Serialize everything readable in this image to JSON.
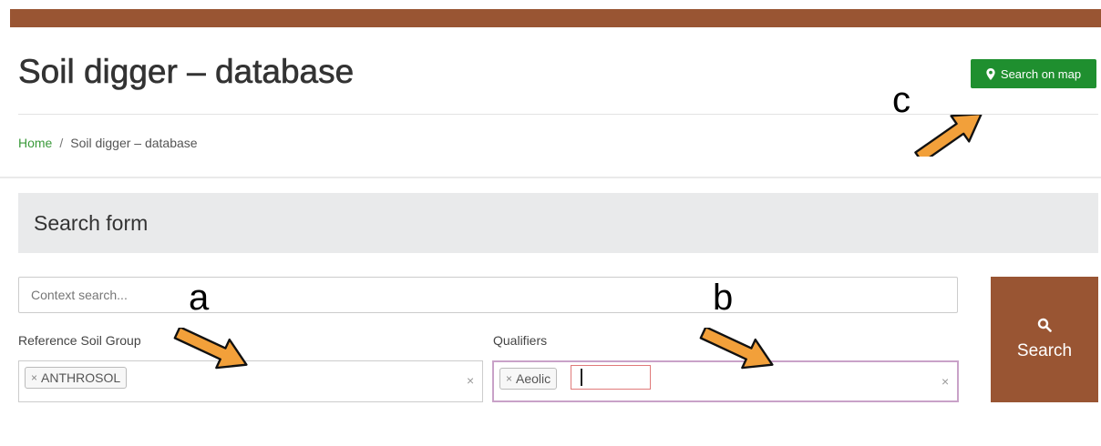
{
  "header": {
    "title": "Soil digger – database",
    "map_button_label": "Search on map"
  },
  "breadcrumb": {
    "home": "Home",
    "separator": "/",
    "current": "Soil digger – database"
  },
  "search_form": {
    "title": "Search form",
    "context_placeholder": "Context search...",
    "rsg_label": "Reference Soil Group",
    "rsg_selected": "ANTHROSOL",
    "qualifiers_label": "Qualifiers",
    "qualifiers_selected": "Aeolic",
    "chip_remove": "×",
    "clear_symbol": "×",
    "search_button_label": "Search"
  },
  "annotations": {
    "a": "a",
    "b": "b",
    "c": "c"
  },
  "colors": {
    "brand_brown": "#995533",
    "map_button_green": "#1f8f2f",
    "breadcrumb_link_green": "#3a9a3a",
    "arrow_orange": "#f2a03a"
  },
  "icons": {
    "map_button": "map-marker-icon",
    "search_button": "search-icon"
  }
}
